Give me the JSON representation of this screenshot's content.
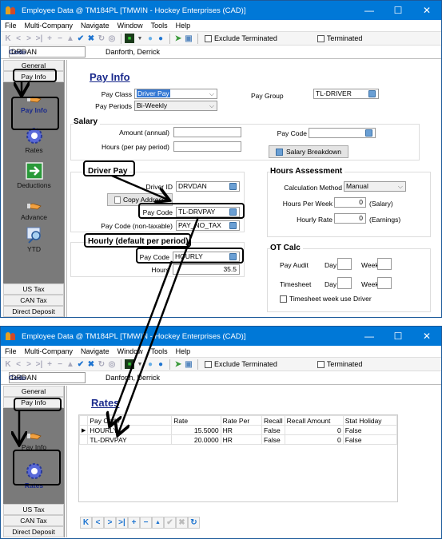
{
  "window1": {
    "title": "Employee Data @ TM184PL [TMWIN - Hockey Enterprises (CAD)]",
    "controls": {
      "minimize": "—",
      "maximize": "☐",
      "close": "✕"
    },
    "menu": [
      "File",
      "Multi-Company",
      "Navigate",
      "Window",
      "Tools",
      "Help"
    ],
    "toolbar": {
      "icons": [
        "first-icon",
        "prev-icon",
        "next-icon",
        "last-icon",
        "add-icon",
        "delete-icon",
        "up-icon",
        "save-check-icon",
        "cancel-x-icon",
        "refresh-icon",
        "view-icon",
        "monitor-icon",
        "dropdown-icon",
        "help-icon",
        "info-icon",
        "green-arrow-icon",
        "window-icon"
      ],
      "exclude_terminated": "Exclude Terminated",
      "terminated": "Terminated"
    },
    "code_label": "Code",
    "code_value": "DRDAN",
    "employee_name": "Danforth,  Derrick",
    "sidebar": {
      "top_tabs": [
        "General",
        "Pay Info"
      ],
      "items": [
        {
          "label": "Pay Info",
          "icon": "hand-pay-icon",
          "active": true
        },
        {
          "label": "Rates",
          "icon": "gear-icon"
        },
        {
          "label": "Deductions",
          "icon": "green-arrow-icon"
        },
        {
          "label": "Advance",
          "icon": "hand-pay-icon"
        },
        {
          "label": "YTD",
          "icon": "magnifier-icon"
        }
      ],
      "bottom_tabs": [
        "US Tax",
        "CAN Tax",
        "Direct Deposit"
      ]
    },
    "payinfo": {
      "heading": "Pay Info",
      "pay_class_label": "Pay Class",
      "pay_class_value": "Driver Pay",
      "pay_periods_label": "Pay Periods",
      "pay_periods_value": "Bi-Weekly",
      "pay_group_label": "Pay Group",
      "pay_group_value": "TL-DRIVER",
      "salary": {
        "title": "Salary",
        "amount_label": "Amount  (annual)",
        "amount_value": "",
        "hours_label": "Hours (per pay period)",
        "hours_value": "",
        "pay_code_label": "Pay Code",
        "pay_code_value": "",
        "breakdown_button": "Salary Breakdown"
      },
      "driver_pay": {
        "title": "Driver Pay",
        "driver_id_label": "Driver ID",
        "driver_id_value": "DRVDAN",
        "copy_address_button": "Copy Address",
        "pay_code_label": "Pay Code",
        "pay_code_value": "TL-DRVPAY",
        "non_taxable_label": "Pay Code (non-taxable)",
        "non_taxable_value": "PAY_NO_TAX"
      },
      "hourly": {
        "title": "Hourly (default per period)",
        "pay_code_label": "Pay Code",
        "pay_code_value": "HOURLY",
        "hours_label": "Hours",
        "hours_value": "35.5"
      },
      "hours_assessment": {
        "title": "Hours Assessment",
        "calc_method_label": "Calculation Method",
        "calc_method_value": "Manual",
        "hours_per_week_label": "Hours Per Week",
        "hours_per_week_value": "0",
        "hours_per_week_suffix": "(Salary)",
        "hourly_rate_label": "Hourly Rate",
        "hourly_rate_value": "0",
        "hourly_rate_suffix": "(Earnings)"
      },
      "ot_calc": {
        "title": "OT Calc",
        "pay_audit_label": "Pay Audit",
        "timesheet_label": "Timesheet",
        "day_label": "Day",
        "week_label": "Week",
        "pay_audit_day": "",
        "pay_audit_week": "",
        "timesheet_day": "",
        "timesheet_week": "",
        "use_driver_label": "Timesheet week use Driver",
        "use_driver_checked": false
      }
    }
  },
  "window2": {
    "title": "Employee Data @ TM184PL [TMWIN - Hockey Enterprises (CAD)]",
    "menu": [
      "File",
      "Multi-Company",
      "Navigate",
      "Window",
      "Tools",
      "Help"
    ],
    "exclude_terminated": "Exclude Terminated",
    "terminated": "Terminated",
    "code_label": "Code",
    "code_value": "DRDAN",
    "employee_name": "Danforth,  Derrick",
    "sidebar": {
      "top_tabs": [
        "General",
        "Pay Info"
      ],
      "items": [
        {
          "label": "Pay Info",
          "icon": "hand-pay-icon"
        },
        {
          "label": "Rates",
          "icon": "gear-icon",
          "active": true
        }
      ],
      "bottom_tabs": [
        "US Tax",
        "CAN Tax",
        "Direct Deposit"
      ]
    },
    "rates": {
      "heading": "Rates",
      "columns": [
        "Pay Code",
        "Rate",
        "Rate Per",
        "Recall",
        "Recall Amount",
        "Stat Holiday"
      ],
      "rows": [
        [
          "HOURLY",
          "15.5000",
          "HR",
          "False",
          "0",
          "False"
        ],
        [
          "TL-DRVPAY",
          "20.0000",
          "HR",
          "False",
          "0",
          "False"
        ]
      ],
      "nav_icons": [
        "first-icon",
        "prev-icon",
        "next-icon",
        "last-icon",
        "add-icon",
        "delete-icon",
        "up-icon",
        "save-check-icon",
        "cancel-x-icon",
        "refresh-icon"
      ]
    }
  }
}
